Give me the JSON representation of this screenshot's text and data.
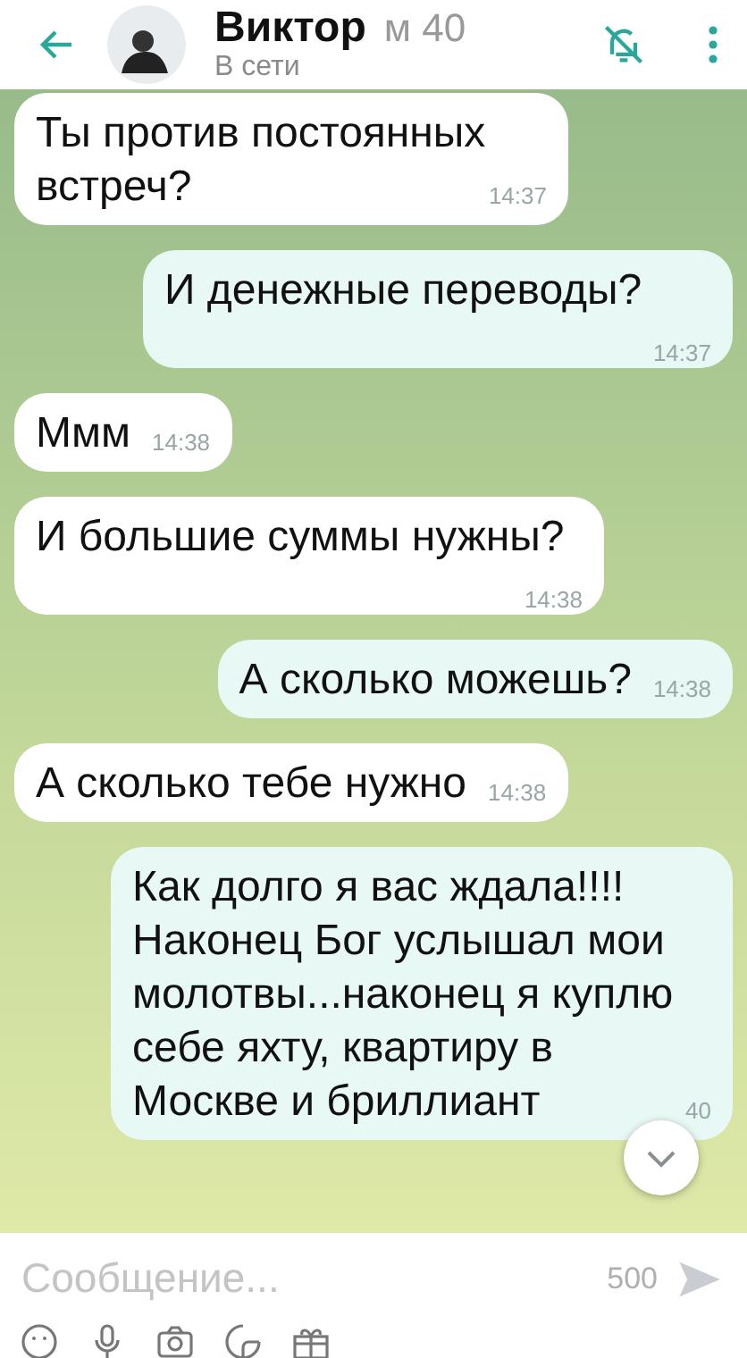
{
  "header": {
    "name": "Виктор",
    "info": "м 40",
    "status": "В сети"
  },
  "messages": [
    {
      "kind": "in",
      "text": "Ты против постоянных встреч?",
      "time": "14:37"
    },
    {
      "kind": "out",
      "text": "И денежные переводы?",
      "time": "14:37"
    },
    {
      "kind": "in",
      "text": "Ммм",
      "time": "14:38"
    },
    {
      "kind": "in",
      "text": "И большие суммы нужны?",
      "time": "14:38"
    },
    {
      "kind": "out",
      "text": "А сколько можешь?",
      "time": "14:38"
    },
    {
      "kind": "in",
      "text": "А сколько тебе нужно",
      "time": "14:38"
    },
    {
      "kind": "out",
      "text": "Как долго я вас ждала!!!! Наконец Бог услышал мои молотвы...наконец я куплю себе яхту, квартиру в Москве и бриллиант",
      "time": "40"
    }
  ],
  "composer": {
    "placeholder": "Сообщение...",
    "counter": "500"
  }
}
